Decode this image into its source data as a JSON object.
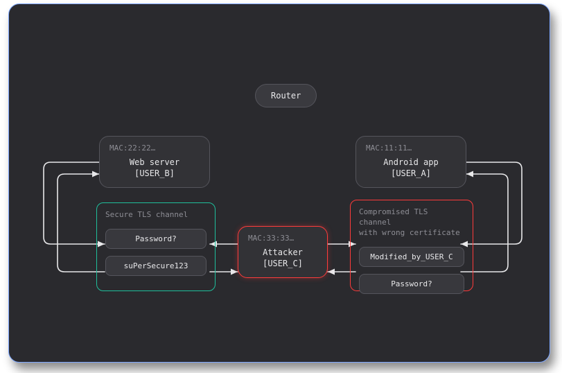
{
  "router": {
    "label": "Router"
  },
  "nodes": {
    "web": {
      "mac": "MAC:22:22…",
      "line1": "Web server",
      "line2": "[USER_B]"
    },
    "android": {
      "mac": "MAC:11:11…",
      "line1": "Android app",
      "line2": "[USER_A]"
    },
    "attacker": {
      "mac": "MAC:33:33…",
      "line1": "Attacker",
      "line2": "[USER_C]"
    }
  },
  "channels": {
    "secure": {
      "label": "Secure TLS channel",
      "msgs": [
        "Password?",
        "suPerSecure123"
      ]
    },
    "bad": {
      "label_l1": "Compromised TLS channel",
      "label_l2": "with wrong certificate",
      "msgs": [
        "Modified_by_USER_C",
        "Password?"
      ]
    }
  },
  "colors": {
    "bg": "#2a2a2e",
    "border": "#7fa8ff",
    "wire": "#e8e8ea",
    "good": "#1fbf9c",
    "bad": "#ff3b3b"
  }
}
